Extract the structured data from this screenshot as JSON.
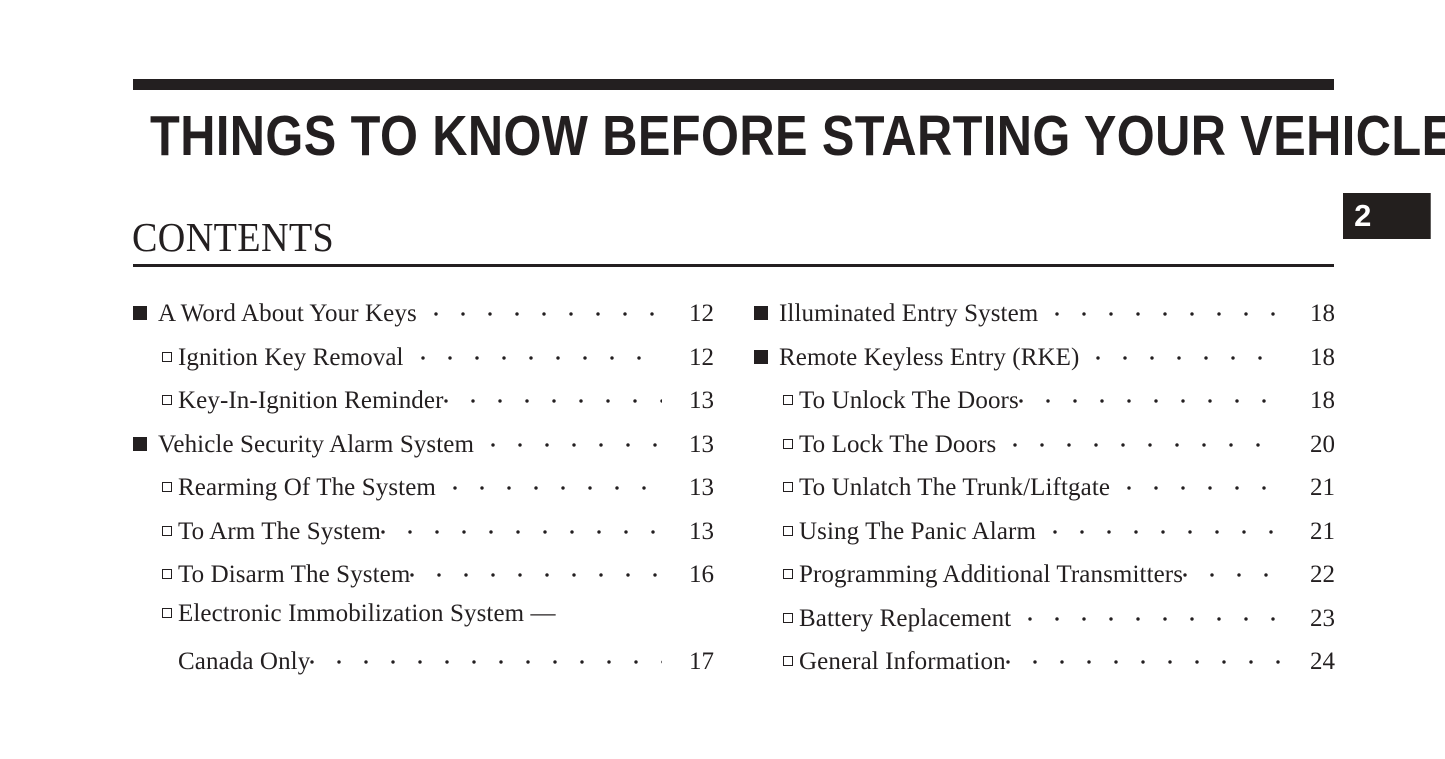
{
  "document": {
    "ink_color": "#231f20",
    "background_color": "#ffffff",
    "page_title": "THINGS TO KNOW BEFORE STARTING YOUR VEHICLE",
    "contents_heading": "CONTENTS",
    "chapter_tab": {
      "number": "2",
      "background_color": "#231f1e",
      "text_color": "#ffffff"
    }
  },
  "toc": {
    "left_column": [
      {
        "level": 1,
        "marker": "filled-square",
        "label": "A Word About Your Keys",
        "page": "12",
        "leader": true,
        "gap": true
      },
      {
        "level": 2,
        "marker": "hollow-square",
        "label": "Ignition Key Removal",
        "page": "12",
        "leader": true,
        "gap": true
      },
      {
        "level": 2,
        "marker": "hollow-square",
        "label": "Key-In-Ignition Reminder",
        "page": "13",
        "leader": true,
        "gap": false
      },
      {
        "level": 1,
        "marker": "filled-square",
        "label": "Vehicle Security Alarm System",
        "page": "13",
        "leader": true,
        "gap": true
      },
      {
        "level": 2,
        "marker": "hollow-square",
        "label": "Rearming Of The System",
        "page": "13",
        "leader": true,
        "gap": true
      },
      {
        "level": 2,
        "marker": "hollow-square",
        "label": "To Arm The System",
        "page": "13",
        "leader": true,
        "gap": false
      },
      {
        "level": 2,
        "marker": "hollow-square",
        "label": "To Disarm The System",
        "page": "16",
        "leader": true,
        "gap": false
      },
      {
        "level": 2,
        "marker": "hollow-square",
        "label": "Electronic Immobilization System —",
        "label_line2": "Canada Only",
        "page": "17",
        "leader": true,
        "gap": false,
        "wrapped": true
      }
    ],
    "right_column": [
      {
        "level": 1,
        "marker": "filled-square",
        "label": "Illuminated Entry System",
        "page": "18",
        "leader": true,
        "gap": true
      },
      {
        "level": 1,
        "marker": "filled-square",
        "label": "Remote Keyless Entry (RKE)",
        "page": "18",
        "leader": true,
        "gap": true
      },
      {
        "level": 2,
        "marker": "hollow-square",
        "label": "To Unlock The Doors",
        "page": "18",
        "leader": true,
        "gap": false
      },
      {
        "level": 2,
        "marker": "hollow-square",
        "label": "To Lock The Doors",
        "page": "20",
        "leader": true,
        "gap": true
      },
      {
        "level": 2,
        "marker": "hollow-square",
        "label": "To Unlatch The Trunk/Liftgate",
        "page": "21",
        "leader": true,
        "gap": true
      },
      {
        "level": 2,
        "marker": "hollow-square",
        "label": "Using The Panic Alarm",
        "page": "21",
        "leader": true,
        "gap": true
      },
      {
        "level": 2,
        "marker": "hollow-square",
        "label": "Programming Additional Transmitters",
        "page": "22",
        "leader": true,
        "gap": false
      },
      {
        "level": 2,
        "marker": "hollow-square",
        "label": "Battery Replacement",
        "page": "23",
        "leader": true,
        "gap": true
      },
      {
        "level": 2,
        "marker": "hollow-square",
        "label": "General Information",
        "page": "24",
        "leader": true,
        "gap": false
      }
    ]
  }
}
